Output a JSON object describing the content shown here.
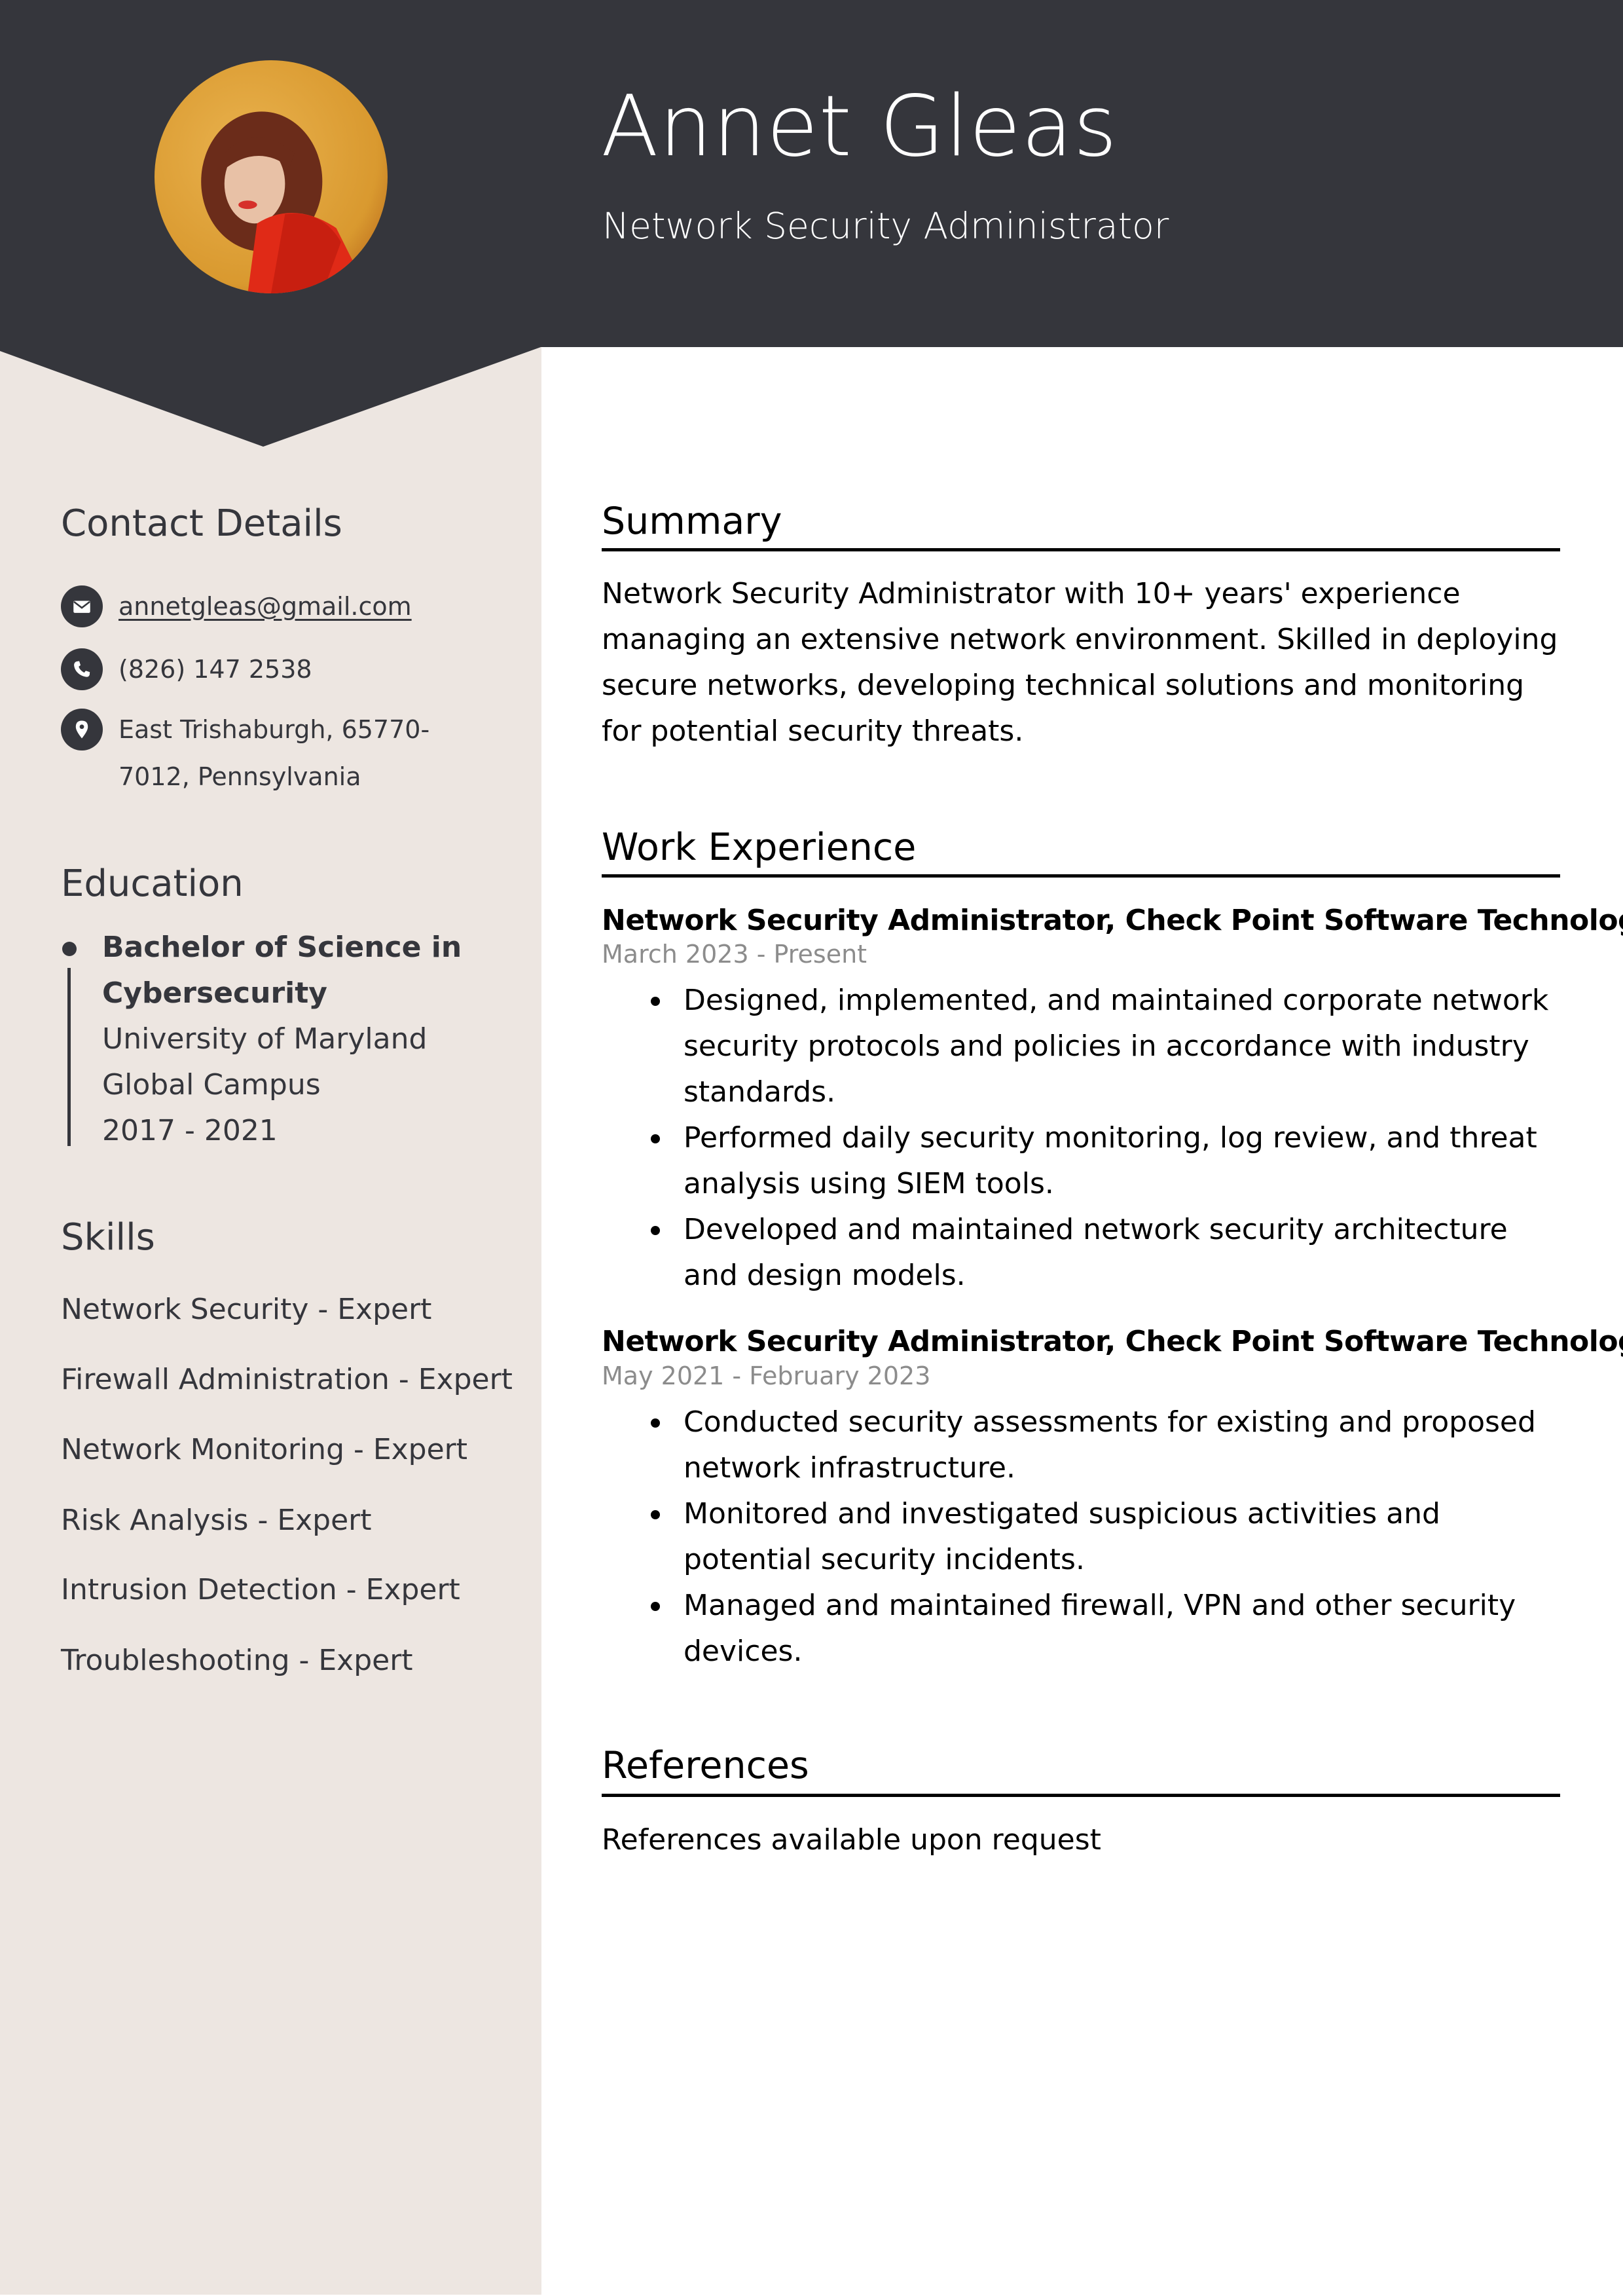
{
  "colors": {
    "header_bg": "#35363c",
    "sidebar_bg": "#ede6e1",
    "accent_text": "#35363c",
    "date_text": "#8c8c8c"
  },
  "header": {
    "name": "Annet Gleas",
    "title": "Network Security Administrator",
    "photo_alt": "Profile photo of Annet Gleas"
  },
  "sidebar": {
    "contact": {
      "title": "Contact Details",
      "email": "annetgleas@gmail.com",
      "phone": "(826) 147 2538",
      "address": "East Trishaburgh, 65770-7012, Pennsylvania",
      "icons": [
        "envelope-icon",
        "phone-icon",
        "location-pin-icon"
      ]
    },
    "education": {
      "title": "Education",
      "items": [
        {
          "degree": "Bachelor of Science in Cybersecurity",
          "school": "University of Maryland Global Campus",
          "years": "2017 - 2021"
        }
      ]
    },
    "skills": {
      "title": "Skills",
      "items": [
        "Network Security - Expert",
        "Firewall Administration - Expert",
        "Network Monitoring - Expert",
        "Risk Analysis - Expert",
        "Intrusion Detection - Expert",
        "Troubleshooting - Expert"
      ]
    }
  },
  "main": {
    "summary": {
      "title": "Summary",
      "text": "Network Security Administrator with 10+ years' experience managing an extensive network environment. Skilled in deploying secure networks, developing technical solutions and monitoring for potential security threats."
    },
    "experience": {
      "title": "Work Experience",
      "jobs": [
        {
          "heading": "Network Security Administrator, Check Point Software Technologies",
          "dates": "March 2023 - Present",
          "bullets": [
            "Designed, implemented, and maintained corporate network security protocols and policies in accordance with industry standards.",
            "Performed daily security monitoring, log review, and threat analysis using SIEM tools.",
            "Developed and maintained network security architecture and design models."
          ]
        },
        {
          "heading": "Network Security Administrator, Check Point Software Technologies",
          "dates": "May 2021 - February 2023",
          "bullets": [
            "Conducted security assessments for existing and proposed network infrastructure.",
            "Monitored and investigated suspicious activities and potential security incidents.",
            "Managed and maintained firewall, VPN and other security devices."
          ]
        }
      ]
    },
    "references": {
      "title": "References",
      "text": "References available upon request"
    }
  }
}
